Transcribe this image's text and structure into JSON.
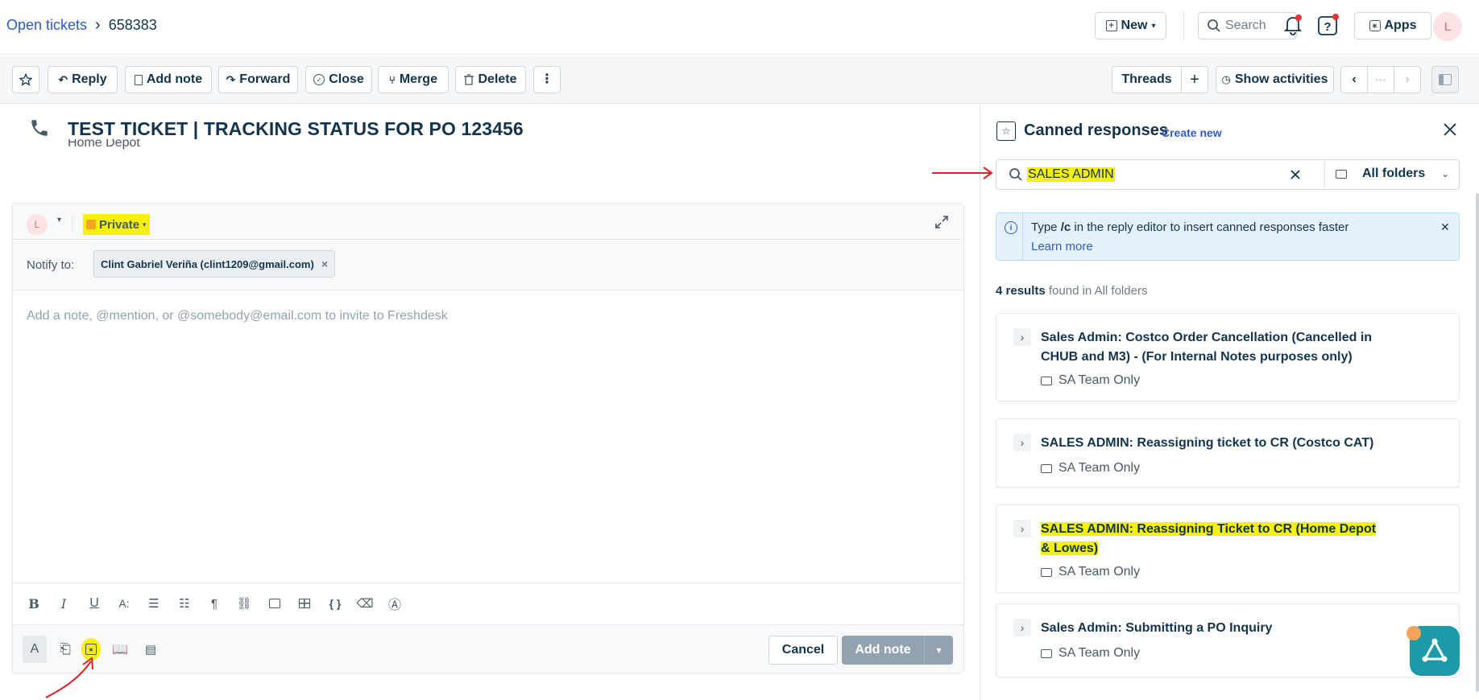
{
  "header": {
    "breadcrumb_root": "Open tickets",
    "breadcrumb_sep": "›",
    "ticket_id": "658383",
    "new_label": "New",
    "search_placeholder": "Search",
    "apps_label": "Apps",
    "avatar_initial": "L"
  },
  "toolbar": {
    "reply": "Reply",
    "add_note": "Add note",
    "forward": "Forward",
    "close": "Close",
    "merge": "Merge",
    "delete": "Delete",
    "threads": "Threads",
    "show_activities": "Show activities"
  },
  "ticket": {
    "title": "TEST TICKET | TRACKING STATUS FOR PO 123456",
    "company": "Home Depot"
  },
  "editor": {
    "avatar_initial": "L",
    "visibility": "Private",
    "notify_label": "Notify to:",
    "notify_chip": "Clint Gabriel Veriña (clint1209@gmail.com)",
    "placeholder": "Add a note, @mention, or @somebody@email.com to invite to Freshdesk",
    "cancel": "Cancel",
    "add_note": "Add note"
  },
  "panel": {
    "title": "Canned responses",
    "create_new": "Create new",
    "search_value": "SALES ADMIN",
    "folder_filter": "All folders",
    "tip_prefix": "Type ",
    "tip_cmd": "/c",
    "tip_suffix": " in the reply editor to insert canned responses faster",
    "tip_link": "Learn more",
    "results_count": "4 results",
    "results_suffix": " found in All folders",
    "results": [
      {
        "title": "Sales Admin: Costco Order Cancellation (Cancelled in CHUB and M3) - (For Internal Notes purposes only)",
        "folder": "SA Team Only"
      },
      {
        "title": "SALES ADMIN: Reassigning ticket to CR (Costco CAT)",
        "folder": "SA Team Only"
      },
      {
        "title": "SALES ADMIN: Reassigning Ticket to CR (Home Depot & Lowes)",
        "folder": "SA Team Only"
      },
      {
        "title": "Sales Admin: Submitting a PO Inquiry",
        "folder": "SA Team Only"
      }
    ]
  },
  "colors": {
    "accent": "#2c5cc5",
    "highlight": "#f6ef12",
    "annotation": "#e02020",
    "fab": "#1b9aaa"
  },
  "icons": [
    "star-icon",
    "reply-icon",
    "note-icon",
    "forward-icon",
    "close-circle-icon",
    "merge-icon",
    "trash-icon",
    "more-vertical-icon",
    "plus-icon",
    "clock-icon",
    "chevron-left-icon",
    "chevron-right-icon",
    "panel-icon",
    "bell-icon",
    "help-icon",
    "apps-icon",
    "search-icon",
    "phone-icon",
    "lock-icon",
    "expand-icon",
    "folder-icon",
    "info-icon",
    "close-icon",
    "canned-response-icon"
  ]
}
